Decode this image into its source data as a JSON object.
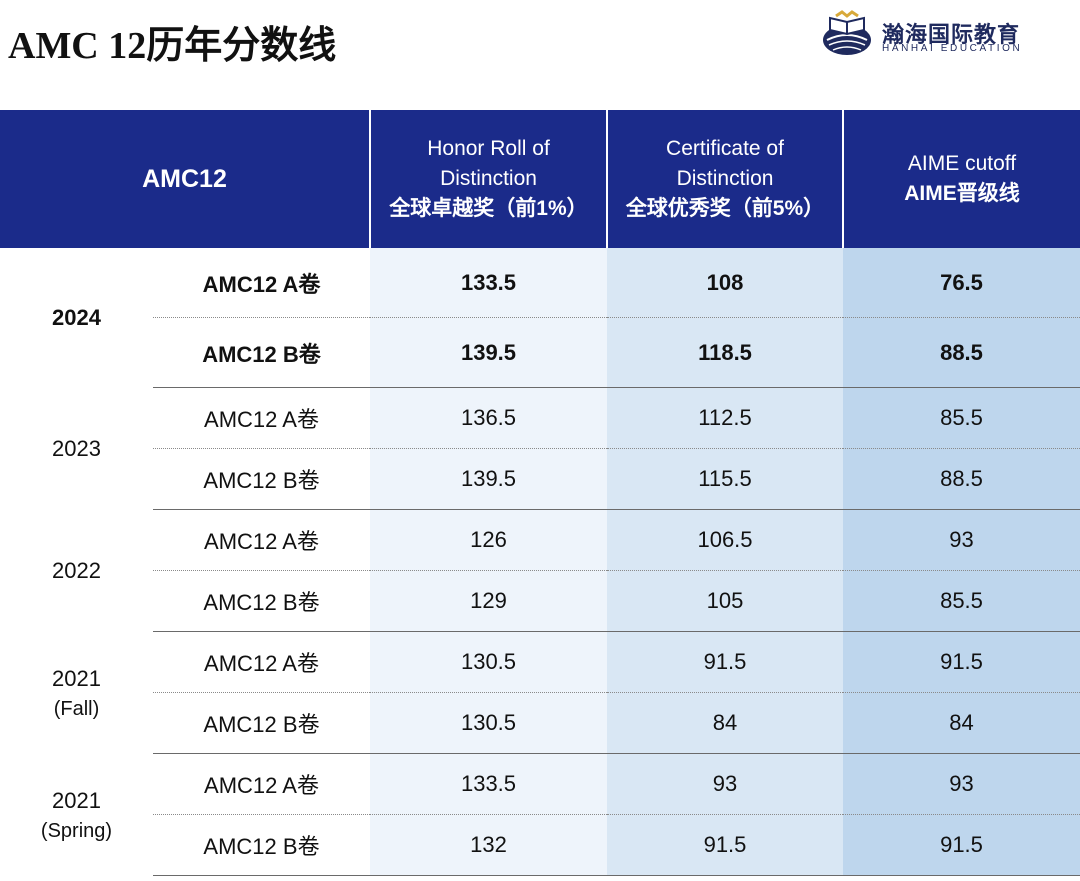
{
  "page": {
    "title": "AMC 12历年分数线"
  },
  "logo": {
    "name_cn": "瀚海国际教育",
    "name_en": "HANHAI EDUCATION",
    "colors": {
      "navy": "#1f2a5e",
      "gold": "#d8a93a"
    }
  },
  "table": {
    "headers": {
      "amc": "AMC12",
      "honor_line1": "Honor Roll of",
      "honor_line2": "Distinction",
      "honor_cn": "全球卓越奖（前1%）",
      "cert_line1": "Certificate of",
      "cert_line2": "Distinction",
      "cert_cn": "全球优秀奖（前5%）",
      "aime_line1": "AIME cutoff",
      "aime_cn": "AIME晋级线"
    },
    "groups": [
      {
        "year": "2024",
        "sub": "",
        "rows": [
          {
            "paper": "AMC12 A卷",
            "honor": "133.5",
            "cert": "108",
            "aime": "76.5"
          },
          {
            "paper": "AMC12 B卷",
            "honor": "139.5",
            "cert": "118.5",
            "aime": "88.5"
          }
        ]
      },
      {
        "year": "2023",
        "sub": "",
        "rows": [
          {
            "paper": "AMC12 A卷",
            "honor": "136.5",
            "cert": "112.5",
            "aime": "85.5"
          },
          {
            "paper": "AMC12 B卷",
            "honor": "139.5",
            "cert": "115.5",
            "aime": "88.5"
          }
        ]
      },
      {
        "year": "2022",
        "sub": "",
        "rows": [
          {
            "paper": "AMC12 A卷",
            "honor": "126",
            "cert": "106.5",
            "aime": "93"
          },
          {
            "paper": "AMC12 B卷",
            "honor": "129",
            "cert": "105",
            "aime": "85.5"
          }
        ]
      },
      {
        "year": "2021",
        "sub": "(Fall)",
        "rows": [
          {
            "paper": "AMC12 A卷",
            "honor": "130.5",
            "cert": "91.5",
            "aime": "91.5"
          },
          {
            "paper": "AMC12 B卷",
            "honor": "130.5",
            "cert": "84",
            "aime": "84"
          }
        ]
      },
      {
        "year": "2021",
        "sub": "(Spring)",
        "rows": [
          {
            "paper": "AMC12 A卷",
            "honor": "133.5",
            "cert": "93",
            "aime": "93"
          },
          {
            "paper": "AMC12 B卷",
            "honor": "132",
            "cert": "91.5",
            "aime": "91.5"
          }
        ]
      }
    ],
    "colors": {
      "header_bg": "#1b2b8a",
      "honor_bg": "#eef4fb",
      "cert_bg": "#d9e7f4",
      "aime_bg": "#bed6ed"
    }
  }
}
